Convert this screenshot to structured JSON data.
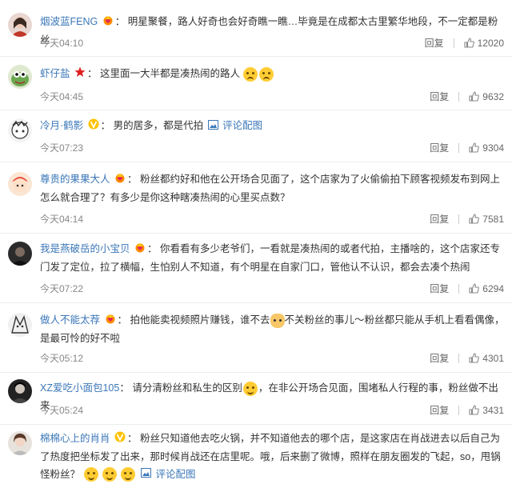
{
  "ui": {
    "reply_label": "回复",
    "like_color": "#888888",
    "link_color": "#3b77b8"
  },
  "comments": [
    {
      "username": "烟波蓝FENG",
      "badge": "heart-crown-icon",
      "text": "明星聚餐，路人好奇也会好奇瞧一瞧…毕竟是在成都太古里繁华地段，不一定都是粉丝",
      "time": "今天04:10",
      "likes": "12020"
    },
    {
      "username": "虾仔盐",
      "badge": "red-star-icon",
      "text": "这里面一大半都是凑热闹的路人",
      "time": "今天04:45",
      "likes": "9632"
    },
    {
      "username": "冷月·鹤影",
      "badge": "vip-v-icon",
      "text": "男的居多，都是代拍",
      "link": "评论配图",
      "time": "今天07:23",
      "likes": "9304"
    },
    {
      "username": "尊贵的果果大人",
      "badge": "heart-crown-icon",
      "text": "粉丝都约好和他在公开场合见面了，这个店家为了火偷偷拍下顾客视频发布到网上怎么就合理了？有多少是你这种瞎凑热闹的心里买点数？",
      "time": "今天04:14",
      "likes": "7581"
    },
    {
      "username": "我是燕破岳的小宝贝",
      "badge": "heart-crown-icon",
      "text": "你看看有多少老爷们，一看就是凑热闹的或者代拍，主播啥的，这个店家还专门发了定位，拉了横幅，生怕别人不知道，有个明星在自家门口，管他认不认识，都会去凑个热闹",
      "time": "今天07:22",
      "likes": "6294"
    },
    {
      "username": "做人不能太荐",
      "badge": "heart-crown-icon",
      "text_a": "拍他能卖视频照片赚钱，谁不去",
      "text_b": "不关粉丝的事儿～粉丝都只能从手机上看看偶像，是最可怜的好不啦",
      "time": "今天05:12",
      "likes": "4301"
    },
    {
      "username": "XZ爱吃小面包105",
      "badge": "",
      "text_a": "请分清粉丝和私生的区别",
      "text_b": "，在非公开场合见面，围堵私人行程的事，粉丝做不出来",
      "time": "今天05:24",
      "likes": "3431"
    },
    {
      "username": "棉棉心上的肖肖",
      "badge": "vip-v-icon",
      "text": "粉丝只知道他去吃火锅，并不知道他去的哪个店，是这家店在肖战进去以后自己为了热度把坐标发了出来，那时候肖战还在店里呢。哦，后来删了微博，照样在朋友圈发的飞起，so，甩锅怪粉丝？",
      "link": "评论配图",
      "time": "",
      "likes": ""
    }
  ]
}
